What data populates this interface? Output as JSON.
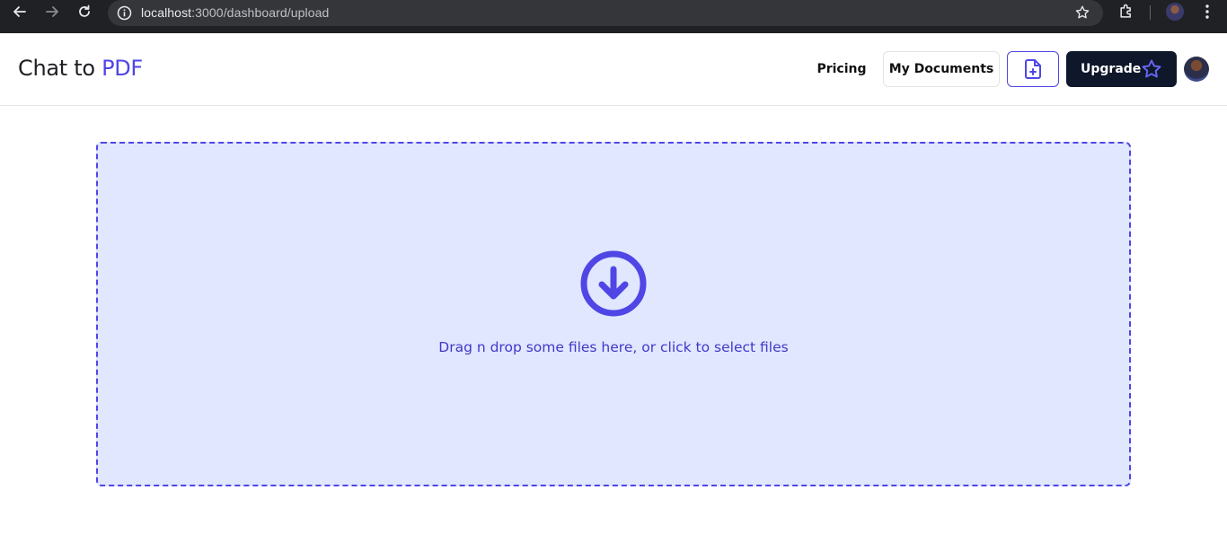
{
  "browser": {
    "url_host": "localhost",
    "url_rest": ":3000/dashboard/upload",
    "icons": [
      "back-icon",
      "forward-icon",
      "reload-icon",
      "site-info-icon",
      "bookmark-star-icon",
      "extensions-icon",
      "profile-avatar",
      "kebab-menu-icon"
    ]
  },
  "header": {
    "brand_prefix": "Chat to",
    "brand_accent": "PDF",
    "pricing_label": "Pricing",
    "documents_label": "My Documents",
    "upgrade_label": "Upgrade",
    "new_document_icon": "file-plus-icon",
    "upgrade_icon": "star-icon"
  },
  "dropzone": {
    "icon": "circle-arrow-down-icon",
    "message": "Drag n drop some files here, or click to select files"
  },
  "colors": {
    "accent": "#4f46e5",
    "dropzone_bg": "#e0e7ff",
    "upgrade_bg": "#0f172a"
  }
}
